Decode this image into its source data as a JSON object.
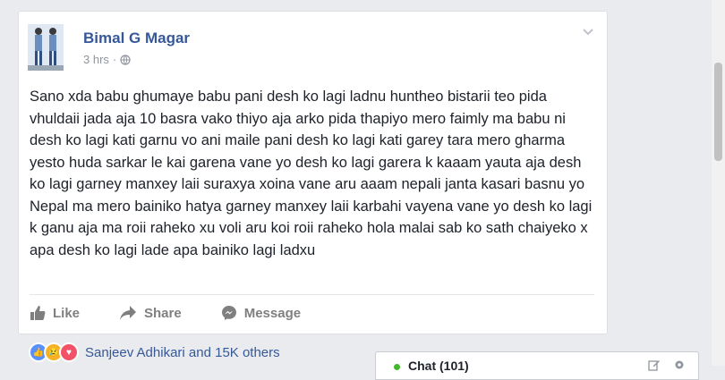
{
  "post": {
    "author": "Bimal G Magar",
    "time": "3 hrs",
    "dot": "·",
    "text": "Sano xda babu ghumaye babu pani desh ko lagi ladnu huntheo bistarii teo pida vhuldaii jada aja 10 basra vako thiyo aja arko pida thapiyo mero faimly ma babu ni desh ko lagi kati garnu vo ani maile pani desh ko lagi kati garey tara mero gharma yesto huda sarkar le kai garena vane yo desh ko lagi garera k kaaam yauta aja desh ko lagi garney manxey laii suraxya xoina vane aru aaam nepali janta kasari basnu yo Nepal ma mero bainiko hatya garney manxey laii karbahi vayena vane yo desh ko lagi k ganu aja ma roii raheko xu voli aru koi roii raheko hola malai sab ko sath chaiyeko x apa desh ko lagi lade apa bainiko lagi ladxu"
  },
  "actions": {
    "like": "Like",
    "share": "Share",
    "message": "Message"
  },
  "reactions": {
    "names": "Sanjeev Adhikari and 15K others"
  },
  "chat": {
    "label": "Chat (101)"
  },
  "colors": {
    "link": "#365899",
    "online": "#42b72a",
    "like_blue": "#5890ff",
    "love_red": "#f25268",
    "sad_yellow": "#f7b125"
  }
}
